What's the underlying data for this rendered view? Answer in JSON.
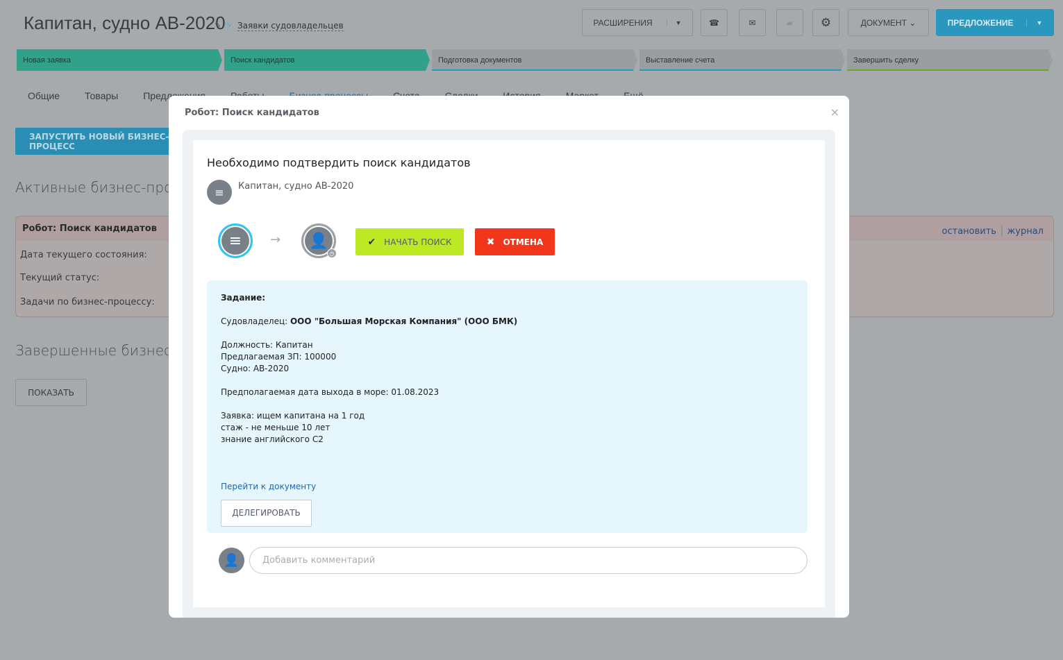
{
  "header": {
    "title": "Капитан, судно АВ-2020",
    "category": "Заявки судовладельцев",
    "extensions": "РАСШИРЕНИЯ",
    "document": "ДОКУМЕНТ",
    "offer": "ПРЕДЛОЖЕНИЕ"
  },
  "stages": [
    "Новая заявка",
    "Поиск кандидатов",
    "Подготовка документов",
    "Выставление счета",
    "Завершить сделку"
  ],
  "tabs": [
    "Общие",
    "Товары",
    "Предложения",
    "Работы",
    "Бизнес-процессы",
    "Счета",
    "Сделки",
    "История",
    "Маркет",
    "Ещё"
  ],
  "bp": {
    "run": "ЗАПУСТИТЬ НОВЫЙ БИЗНЕС-ПРОЦЕСС",
    "active": "Активные бизнес-процессы",
    "panel_title": "Робот: Поиск кандидатов",
    "stop": "остановить",
    "journal": "журнал",
    "rows": [
      "Дата текущего состояния:",
      "Текущий статус:",
      "Задачи по бизнес-процессу:"
    ],
    "completed": "Завершенные бизнес-процессы",
    "show": "ПОКАЗАТЬ"
  },
  "modal": {
    "title": "Робот: Поиск кандидатов",
    "heading": "Необходимо подтвердить поиск кандидатов",
    "entity": "Капитан, судно АВ-2020",
    "start": "НАЧАТЬ ПОИСК",
    "cancel": "ОТМЕНА",
    "task": {
      "label": "Задание:",
      "owner_label": "Судовладелец: ",
      "owner": "ООО \"Большая Морская Компания\" (ООО БМК)",
      "position": "Должность: Капитан",
      "salary": "Предлагаемая ЗП: 100000",
      "ship": "Судно: АВ-2020",
      "date": "Предполагаемая дата выхода в море: 01.08.2023",
      "req1": "Заявка: ищем капитана на 1 год",
      "req2": "стаж - не меньше 10 лет",
      "req3": "знание английского С2",
      "link": "Перейти к документу",
      "delegate": "ДЕЛЕГИРОВАТЬ"
    },
    "comment_placeholder": "Добавить комментарий"
  }
}
